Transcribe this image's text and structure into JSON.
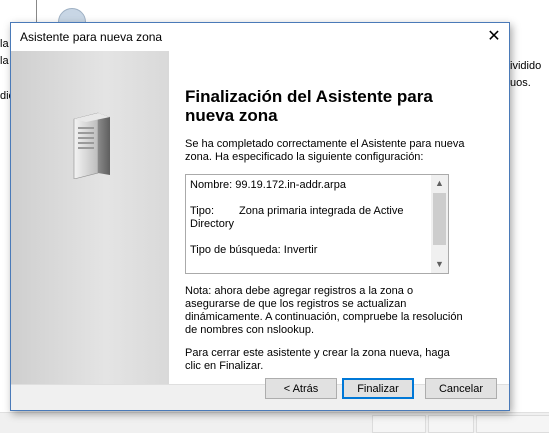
{
  "background": {
    "left_fragments": [
      "la",
      "la",
      "dic"
    ],
    "right_fragments": [
      "ividido",
      "uos."
    ]
  },
  "dialog": {
    "title": "Asistente para nueva zona",
    "close_glyph": "✕",
    "heading": "Finalización del Asistente para nueva zona",
    "intro": "Se ha completado correctamente el Asistente para nueva zona. Ha especificado la siguiente configuración:",
    "summary": {
      "name_label": "Nombre:",
      "name_value": "99.19.172.in-addr.arpa",
      "type_label": "Tipo:",
      "type_value": "Zona primaria integrada de Active Directory",
      "lookup_label": "Tipo de búsqueda:",
      "lookup_value": "Invertir"
    },
    "note": "Nota: ahora debe agregar registros a la zona o asegurarse de que los registros se actualizan dinámicamente. A continuación, compruebe la resolución de nombres con nslookup.",
    "closing": "Para cerrar este asistente y crear la zona nueva, haga clic en Finalizar.",
    "buttons": {
      "back": "< Atrás",
      "finish": "Finalizar",
      "cancel": "Cancelar"
    },
    "icons": {
      "server": "server-icon",
      "scroll_up": "▲",
      "scroll_down": "▼"
    }
  }
}
